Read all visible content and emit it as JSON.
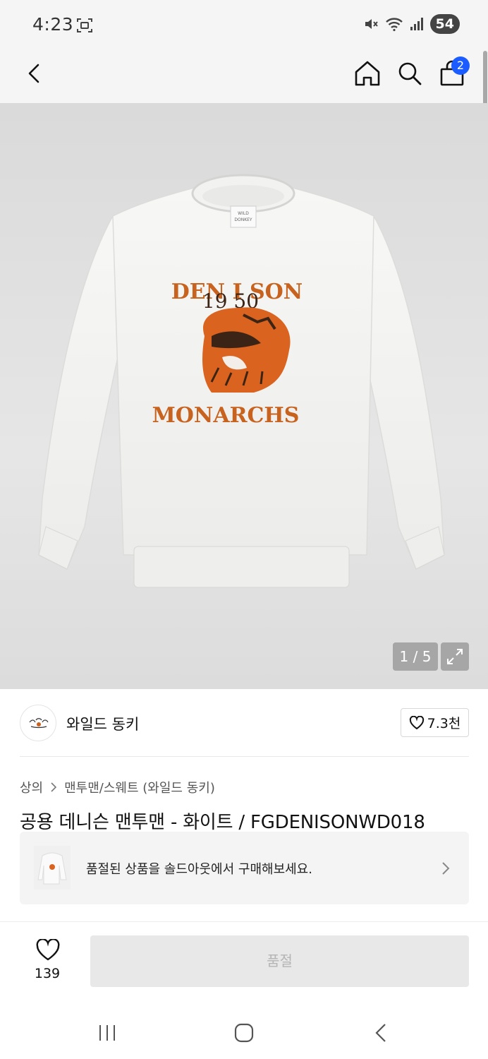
{
  "status_bar": {
    "time": "4:23",
    "battery": "54",
    "icons": [
      "screenshot-icon",
      "mute-icon",
      "wifi-icon",
      "signal-icon"
    ]
  },
  "topbar": {
    "icons": [
      "back-icon",
      "home-icon",
      "search-icon",
      "cart-icon"
    ],
    "cart_count": "2"
  },
  "gallery": {
    "counter": "1 / 5",
    "print": {
      "line1": "DEN I SON",
      "line2": "19 50",
      "line3": "MONARCHS"
    },
    "label": {
      "line1": "WILD",
      "line2": "DONKEY"
    }
  },
  "brand": {
    "name": "와일드 동키",
    "likes": "7.3천"
  },
  "breadcrumb": {
    "category": "상의",
    "subcategory": "맨투맨/스웨트 (와일드 동키)"
  },
  "product": {
    "title": "공용 데니슨 맨투맨 - 화이트 / FGDENISONWD018"
  },
  "soldout_banner": {
    "text": "품절된 상품을 솔드아웃에서 구매해보세요."
  },
  "bottom_bar": {
    "wish_count": "139",
    "button_label": "품절"
  },
  "colors": {
    "accent": "#1a5cff",
    "print_orange": "#d9631f",
    "print_brown": "#8a4a1e"
  }
}
